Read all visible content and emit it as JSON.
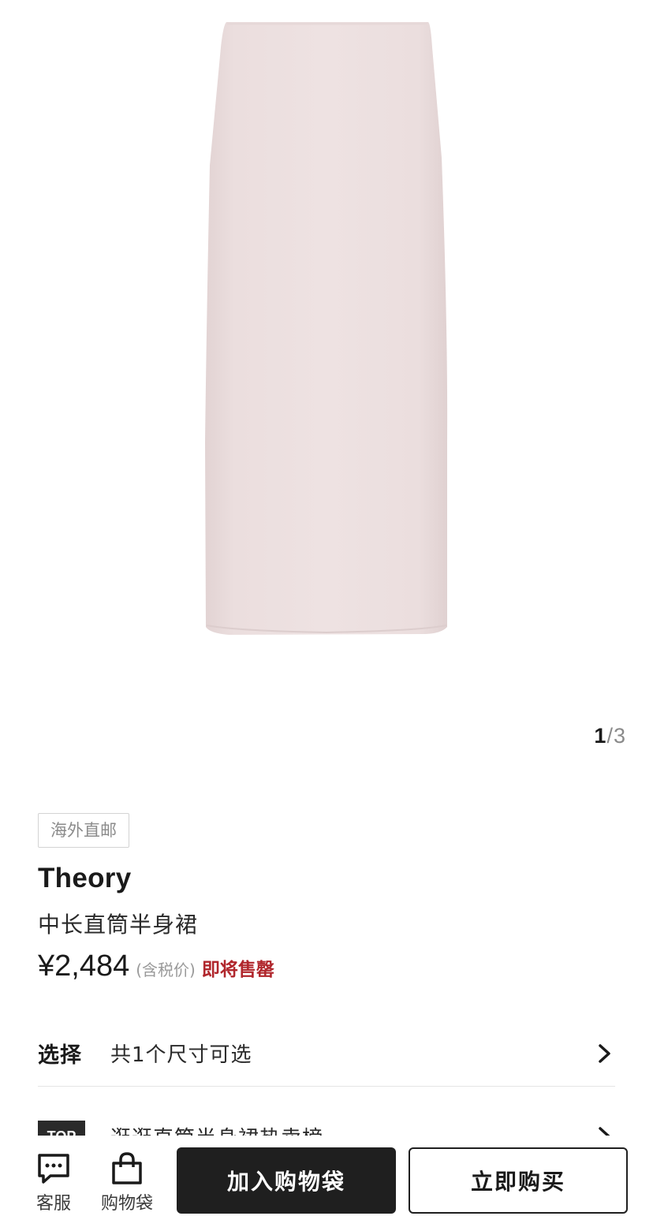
{
  "gallery": {
    "image_alt": "pale pink midi pencil skirt",
    "pager_current": "1",
    "pager_separator": "/",
    "pager_total": "3"
  },
  "product": {
    "tag": "海外直邮",
    "brand": "Theory",
    "name": "中长直筒半身裙",
    "price": "¥2,484",
    "tax_note": "(含税价)",
    "stock_status": "即将售罄"
  },
  "options": {
    "select_label": "选择",
    "select_value": "共1个尺寸可选"
  },
  "top_row": {
    "badge": "TOP",
    "text": "逛逛直筒半身裙热卖榜"
  },
  "bottom_bar": {
    "service_label": "客服",
    "bag_label": "购物袋",
    "add_to_bag": "加入购物袋",
    "buy_now": "立即购买"
  },
  "colors": {
    "skirt": "#eadcdc",
    "primary_button": "#1f1f1f",
    "sale_red": "#b0262c"
  },
  "icons": [
    "chat-bubble-icon",
    "shopping-bag-icon",
    "chevron-right-icon"
  ]
}
